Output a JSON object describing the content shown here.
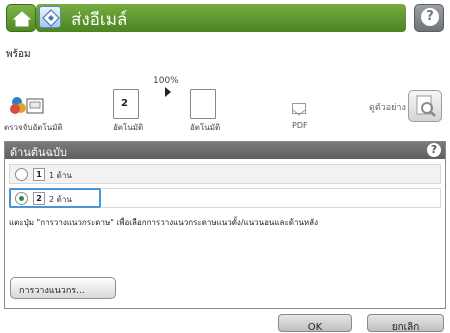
{
  "header": {
    "title": "ส่งอีเมล์",
    "home_icon": "home-icon",
    "app_icon": "email-app-icon",
    "help_icon": "help-icon",
    "help_glyph": "?"
  },
  "status": "พร้อม",
  "toolbar": {
    "scan_label": "ตรวจจับอัตโนมัติ",
    "auto_label_1": "อัตโนมัติ",
    "zoom": "100%",
    "auto_label_2": "อัตโนมัติ",
    "pdf_label": "PDF",
    "preview_label": "ดูตัวอย่าง",
    "doc_badge": "2"
  },
  "panel": {
    "title": "ด้านต้นฉบับ",
    "help_glyph": "?",
    "options": [
      {
        "badge": "1",
        "label": "1 ด้าน",
        "selected": false
      },
      {
        "badge": "2",
        "label": "2 ด้าน",
        "selected": true
      }
    ],
    "instructions": "แตะปุ่ม \"การวางแนวกระดาษ\" เพื่อเลือกการวางแนวกระดาษแนวตั้ง/แนวนอนและด้านหลัง",
    "layout_button": "การวางแนวกร..."
  },
  "footer": {
    "ok": "OK",
    "cancel": "ยกเลิก"
  },
  "colors": {
    "title_green": "#5e9a2f",
    "panel_header": "#6b6b6b",
    "selection_blue": "#4a95d6"
  }
}
